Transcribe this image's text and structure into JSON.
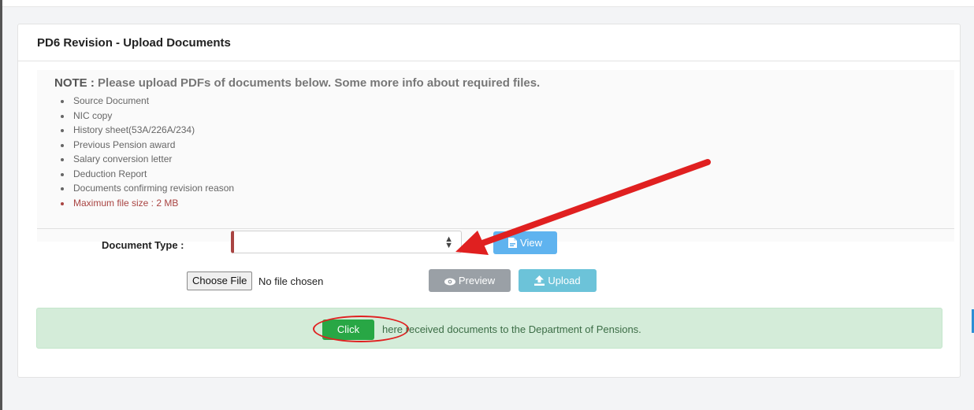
{
  "panel": {
    "title": "PD6 Revision - Upload Documents"
  },
  "note": {
    "label": "NOTE :",
    "text": "Please upload PDFs of documents below. Some more info about required files.",
    "items": [
      "Source Document",
      "NIC copy",
      "History sheet(53A/226A/234)",
      "Previous Pension award",
      "Salary conversion letter",
      "Deduction Report",
      "Documents confirming revision reason"
    ],
    "max_size": "Maximum file size : 2 MB"
  },
  "form": {
    "doc_type_label": "Document Type :",
    "doc_type_value": "",
    "view_label": "View",
    "choose_file_label": "Choose File",
    "file_status": "No file chosen",
    "preview_label": "Preview",
    "upload_label": "Upload"
  },
  "send": {
    "button_label": "Click",
    "text": "here received documents to the Department of Pensions."
  },
  "icons": {
    "view": "pdf-file-icon",
    "preview": "eye-icon",
    "upload": "upload-icon",
    "select": "select-caret-icon"
  },
  "colors": {
    "view_button": "#5fb3ef",
    "preview_button": "#9aa0a6",
    "upload_button": "#6cc3d9",
    "click_button": "#28a745",
    "success_bg": "#d4ecd9",
    "annotation": "#e02020",
    "required_marker": "#a94442"
  }
}
